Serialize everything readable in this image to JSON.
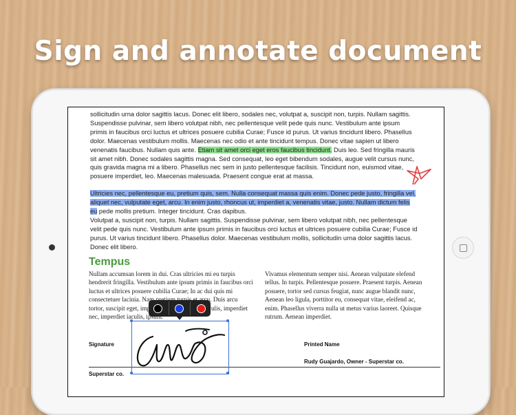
{
  "headline": "Sign and annotate document",
  "document": {
    "para1_a": "sollicitudin urna dolor sagittis lacus. Donec elit libero, sodales nec, volutpat a, suscipit non, turpis. Nullam sagittis. Suspendisse pulvinar, sem libero volutpat nibh, nec pellentesque velit pede quis nunc. Vestibulum ante ipsum primis in faucibus orci luctus et ultrices posuere cubilia Curae; Fusce id purus. Ut varius tincidunt libero. Phasellus dolor. Maecenas vestibulum mollis. Maecenas nec odio et ante tincidunt tempus. Donec vitae sapien ut libero venenatis faucibus. Nullam quis ante. ",
    "para1_highlight": "Etiam sit amet orci eget eros faucibus tincidunt.",
    "para1_b": " Duis leo. Sed fringilla mauris sit amet nibh. Donec sodales sagittis magna. Sed consequat, leo eget bibendum sodales, augue velit cursus nunc, quis gravida magna mi a libero. Phasellus nec sem in justo pellentesque facilisis. Tincidunt non, euismod vitae, posuere imperdiet, leo. Maecenas malesuada. Praesent congue erat at massa.",
    "para2_highlight": "Ultricies nec, pellentesque eu, pretium quis, sem. Nulla consequat massa quis enim. Donec pede justo, fringilla vel, aliquet nec, vulputate eget, arcu. In enim justo, rhoncus ut, imperdiet a, venenatis vitae, justo. Nullam dictum felis eu",
    "para2_b": " pede mollis pretium. Integer tincidunt. Cras dapibus.",
    "para3": "Volutpat a, suscipit non, turpis. Nullam sagittis. Suspendisse pulvinar, sem libero volutpat nibh, nec pellentesque velit pede quis nunc. Vestibulum ante ipsum primis in faucibus orci luctus et ultrices posuere cubilia Curae; Fusce id purus. Ut varius tincidunt libero. Phasellus dolor. Maecenas vestibulum mollis, sollicitudin urna dolor sagittis lacus. Donec elit libero.",
    "heading": "Tempus",
    "col_left": "Nullam accumsan lorem in dui. Cras ultricies mi eu turpis hendrerit fringilla. Vestibulum ante ipsum primis in faucibus orci luctus et ultrices posuere cubilia Curae; In ac dui quis mi consectetuer lacinia. Nam pretium turpis et arcu. Duis arcu tortor, suscipit eget, imperdiet nec, imperdiet iaculis, imperdiet nec, imperdiet iaculis, ipsum.",
    "col_right": "Vivamus elementum semper nisi. Aenean vulputate elefend tellus. In turpis. Pellentesque posuere. Praesent turpis. Aenean posuere, tortor sed cursus feugiat, nunc augue blandit nunc, Aenean leo ligula, porttitor eu, consequat vitae, eleifend ac, enim. Phasellus viverra nulla ut metus varius laoreet. Quisque rutrum. Aenean imperdiet.",
    "signature_label": "Signature",
    "printed_name_label": "Printed Name",
    "printed_name_value": "Rudy Guajardo, Owner - Superstar co.",
    "company": "Superstar co."
  },
  "toolbar": {
    "colors": [
      "#000000",
      "#1e3de0",
      "#e01e1e"
    ]
  },
  "colors": {
    "highlight_green": "#8fe08f",
    "highlight_blue": "#8fb0f3",
    "heading_green": "#4a9a3d",
    "annotation_red": "#e23b3b",
    "selection_blue": "#3a6fd8"
  }
}
